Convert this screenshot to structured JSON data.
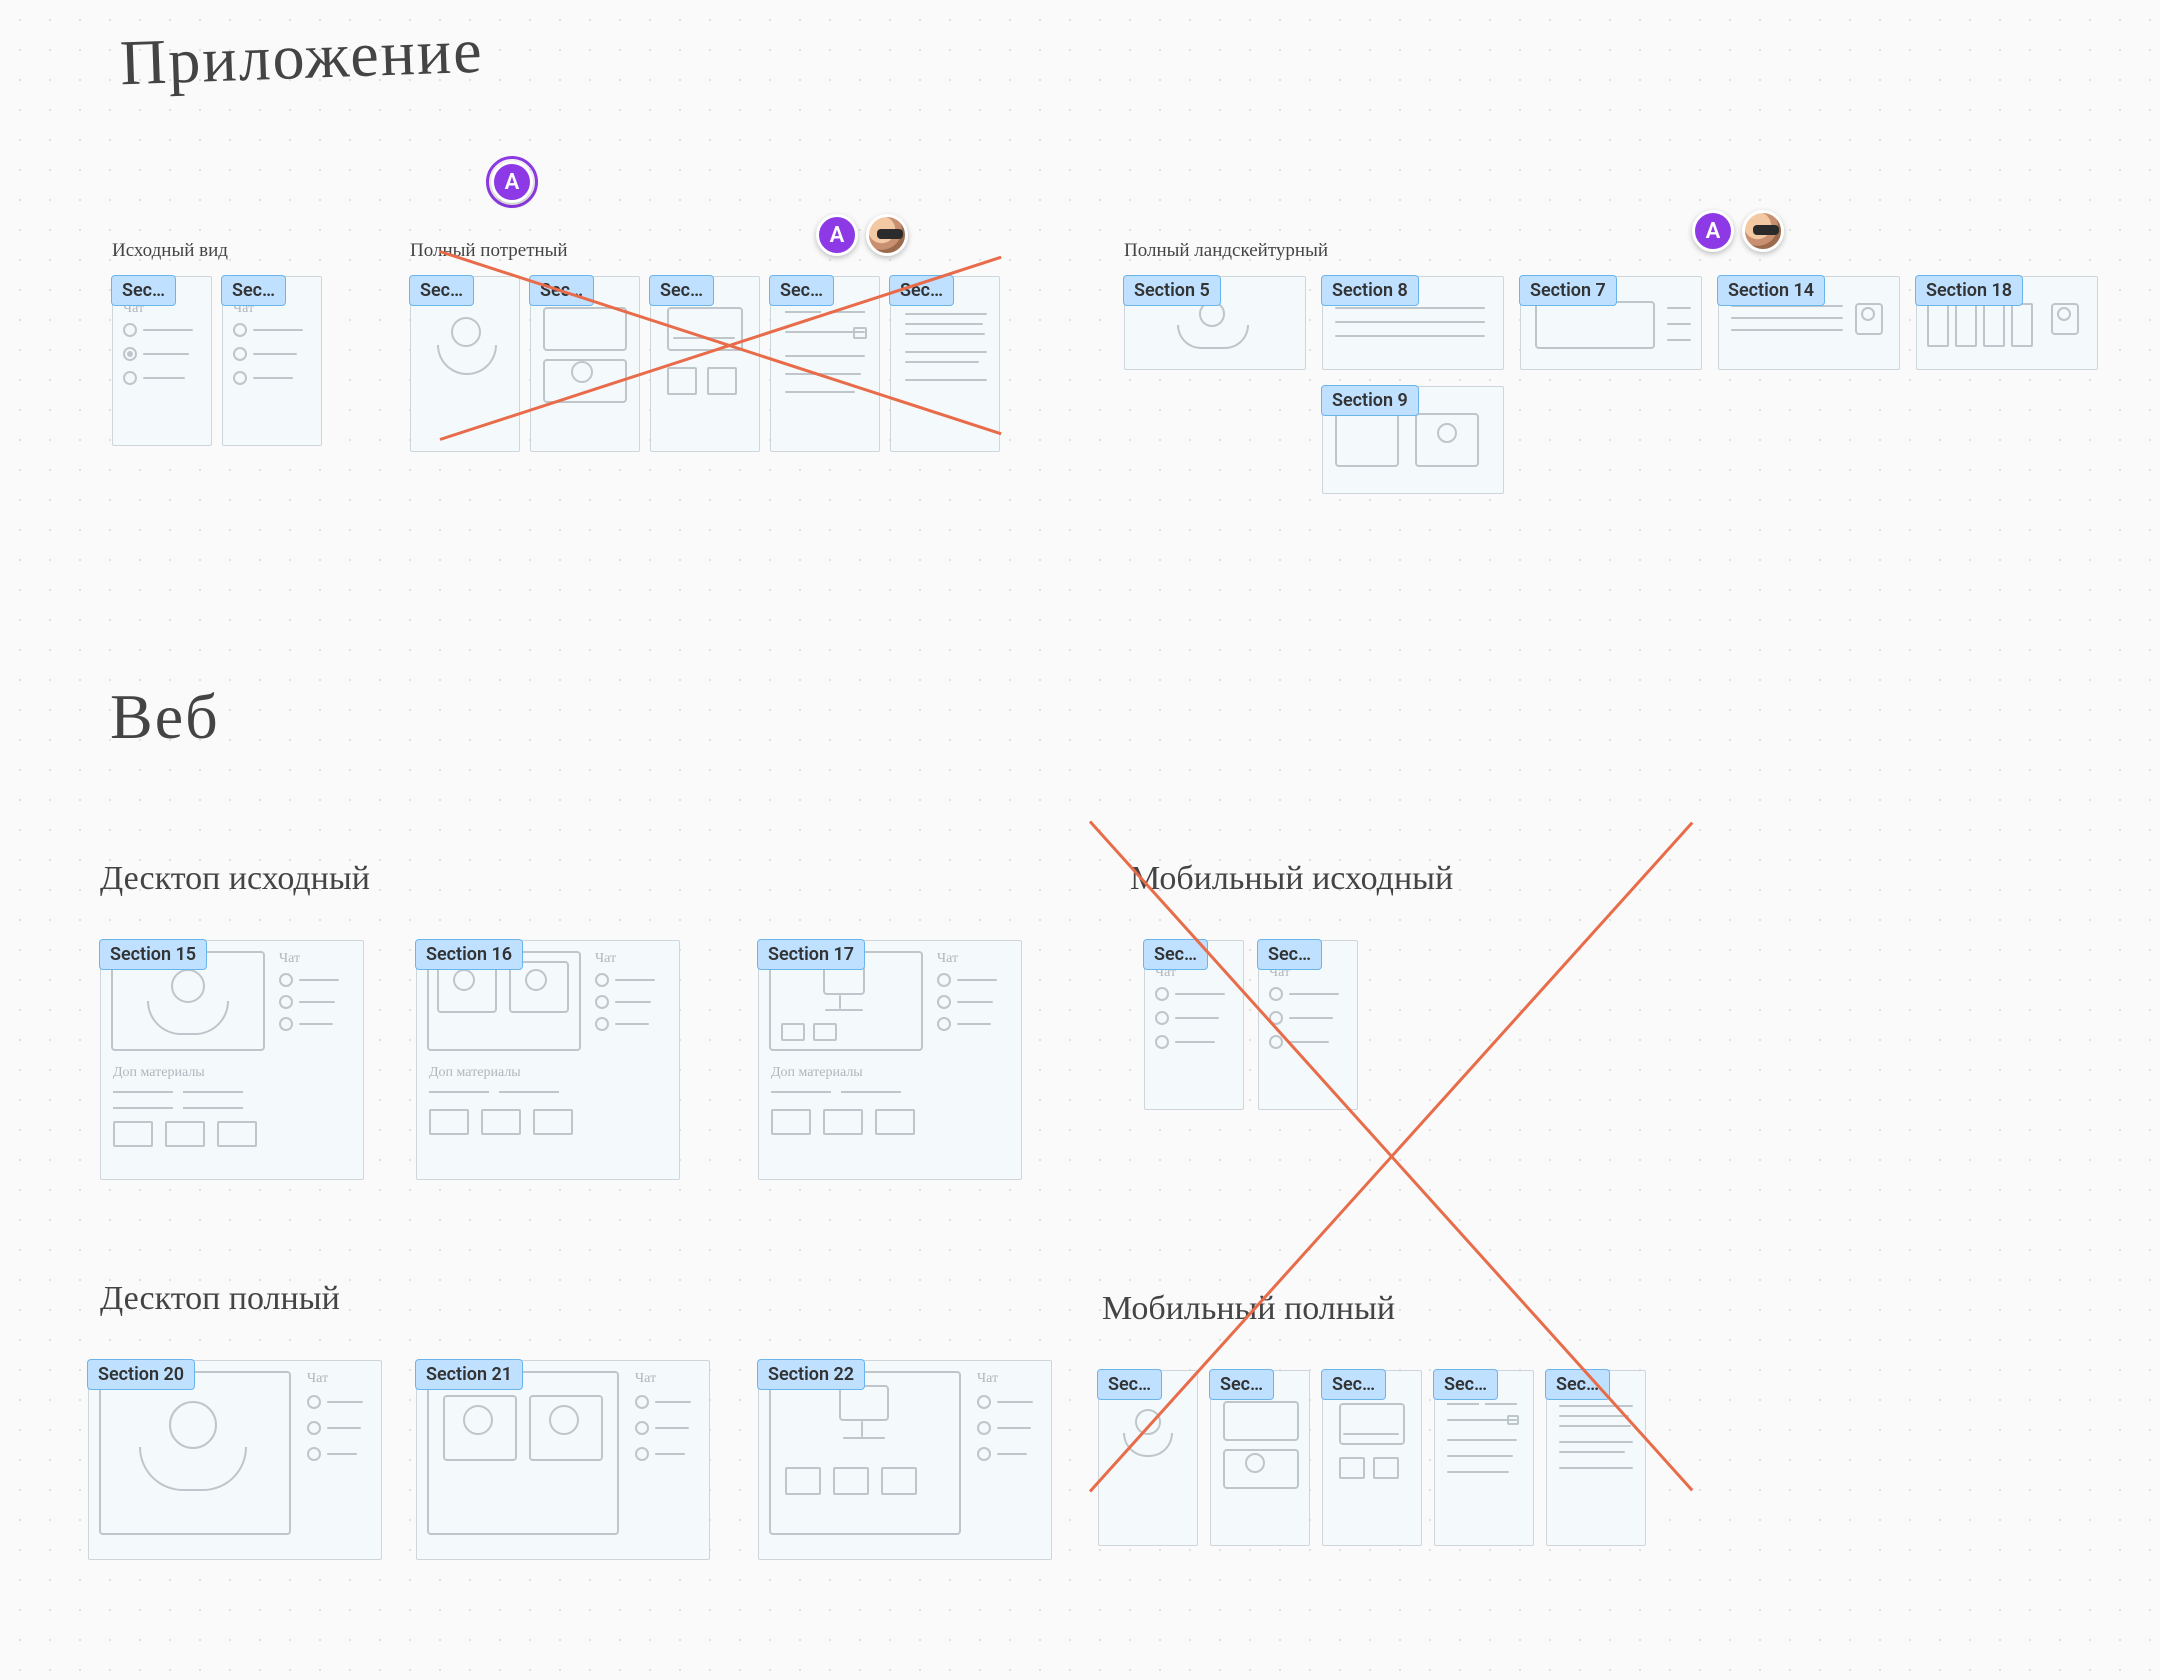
{
  "headings": {
    "app": "Приложение",
    "web": "Веб"
  },
  "sublabels": {
    "src_view": "Исходный вид",
    "full_portrait": "Полный потретный",
    "full_landscape": "Полный ландскейтурный",
    "desktop_src": "Десктоп исходный",
    "desktop_full": "Десктоп полный",
    "mobile_src": "Мобильный исходный",
    "mobile_full": "Мобильный полный",
    "dop_materialy": "Доп материалы",
    "chat": "Чат"
  },
  "avatar_letter": "A",
  "sections": {
    "sec_trunc": "Sec…",
    "s5": "Section 5",
    "s7": "Section 7",
    "s8": "Section 8",
    "s9": "Section 9",
    "s14": "Section 14",
    "s15": "Section 15",
    "s16": "Section 16",
    "s17": "Section 17",
    "s18": "Section 18",
    "s20": "Section 20",
    "s21": "Section 21",
    "s22": "Section 22"
  }
}
